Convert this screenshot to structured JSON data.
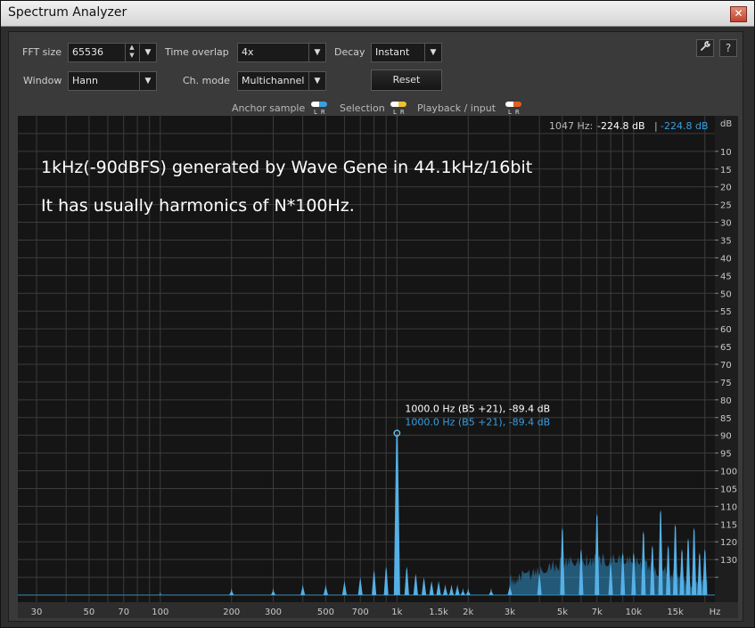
{
  "window": {
    "title": "Spectrum Analyzer",
    "close_glyph": "✕"
  },
  "controls": {
    "fft_size_label": "FFT size",
    "fft_size_value": "65536",
    "time_overlap_label": "Time overlap",
    "time_overlap_value": "4x",
    "decay_label": "Decay",
    "decay_value": "Instant",
    "window_label": "Window",
    "window_value": "Hann",
    "ch_mode_label": "Ch. mode",
    "ch_mode_value": "Multichannel",
    "reset_label": "Reset",
    "settings_icon": "wrench-icon",
    "help_glyph": "?"
  },
  "legend": {
    "anchor_label": "Anchor sample",
    "anchor_left_color": "#ffffff",
    "anchor_right_color": "#3aa0e0",
    "selection_label": "Selection",
    "selection_left_color": "#ffffff",
    "selection_right_color": "#f0c030",
    "playback_label": "Playback / input",
    "playback_left_color": "#ffffff",
    "playback_right_color": "#e06020",
    "lr_text": "LR"
  },
  "readout": {
    "freq": "1047 Hz:",
    "left_db": "-224.8 dB",
    "sep": "|",
    "right_db": "-224.8 dB"
  },
  "annotation": {
    "line1": "1kHz(-90dBFS) generated by Wave Gene in 44.1kHz/16bit",
    "line2": "It has usually harmonics of N*100Hz."
  },
  "marker": {
    "label_white": "1000.0 Hz (B5 +21), -89.4 dB",
    "label_blue": "1000.0 Hz (B5 +21), -89.4 dB",
    "freq": 1000,
    "db": -89.4
  },
  "colors": {
    "spectrum": "#2f8fc8",
    "spectrum_light": "#55b0e6",
    "grid": "#3c3c3c",
    "plot_bg": "#151515",
    "readout_blue": "#3a9ee0"
  },
  "chart_data": {
    "type": "line",
    "title": "",
    "xlabel": "Hz",
    "ylabel": "dB",
    "x_scale": "log",
    "xlim": [
      25,
      22050
    ],
    "ylim": [
      -137,
      0
    ],
    "x_ticks": [
      30,
      50,
      70,
      100,
      200,
      300,
      500,
      700,
      1000,
      1500,
      2000,
      3000,
      5000,
      7000,
      10000,
      15000
    ],
    "x_tick_labels": [
      "30",
      "50",
      "70",
      "100",
      "200",
      "300",
      "500",
      "700",
      "1k",
      "1.5k",
      "2k",
      "3k",
      "5k",
      "7k",
      "10k",
      "15k",
      "Hz"
    ],
    "y_ticks": [
      -10,
      -15,
      -20,
      -25,
      -30,
      -35,
      -40,
      -45,
      -50,
      -55,
      -60,
      -65,
      -70,
      -75,
      -80,
      -85,
      -90,
      -95,
      -100,
      -105,
      -110,
      -115,
      -120,
      -125,
      -130
    ],
    "y_tick_labels": [
      "dB",
      "10",
      "15",
      "20",
      "25",
      "30",
      "35",
      "40",
      "45",
      "50",
      "55",
      "60",
      "65",
      "70",
      "75",
      "80",
      "85",
      "90",
      "95",
      "100",
      "105",
      "110",
      "115",
      "120",
      "130"
    ],
    "grid": true,
    "noise_floor_db": -135,
    "series": [
      {
        "peaks_x": [
          100,
          200,
          300,
          400,
          500,
          600,
          700,
          800,
          900,
          1000,
          1100,
          1200,
          1300,
          1400,
          1500,
          1600,
          1700,
          1800,
          1900,
          2000,
          2500,
          3000,
          4000,
          5000,
          6000,
          7000,
          8000,
          9000,
          10000,
          11000,
          12000,
          13000,
          14000,
          15000,
          16000,
          17000,
          18000,
          19000,
          20000
        ],
        "peaks_y": [
          -134,
          -133,
          -133,
          -132,
          -132,
          -131,
          -130,
          -128,
          -127,
          -89.4,
          -127,
          -129,
          -130,
          -131,
          -131,
          -132,
          -132,
          -132,
          -133,
          -133,
          -133,
          -132,
          -129,
          -116,
          -122,
          -112,
          -126,
          -123,
          -123,
          -117,
          -121,
          -111,
          -121,
          -115,
          -122,
          -119,
          -116,
          -123,
          -122
        ]
      }
    ]
  }
}
